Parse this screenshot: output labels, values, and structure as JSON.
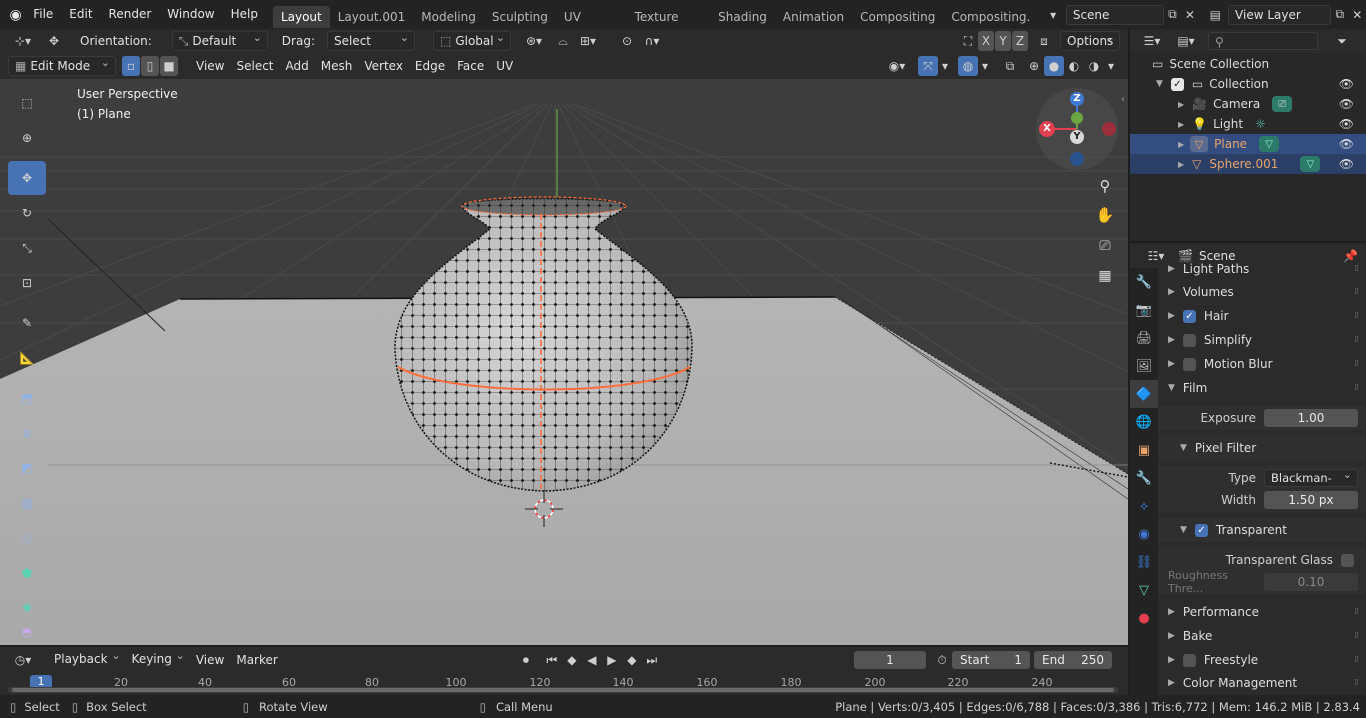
{
  "topbar": {
    "menus": [
      "File",
      "Edit",
      "Render",
      "Window",
      "Help"
    ],
    "workspaces": [
      "Layout",
      "Layout.001",
      "Modeling",
      "Sculpting",
      "UV Editing",
      "Texture Paint",
      "Shading",
      "Animation",
      "Compositing",
      "Compositing."
    ],
    "active_workspace": "Layout",
    "scene": "Scene",
    "view_layer": "View Layer"
  },
  "viewport_header": {
    "orientation_label": "Orientation:",
    "orientation_value": "Default",
    "drag_label": "Drag:",
    "drag_value": "Select Box",
    "transform_orientation": "Global",
    "axes": [
      "X",
      "Y",
      "Z"
    ],
    "options": "Options",
    "mode": "Edit Mode",
    "menus": [
      "View",
      "Select",
      "Add",
      "Mesh",
      "Vertex",
      "Edge",
      "Face",
      "UV"
    ]
  },
  "viewport": {
    "perspective": "User Perspective",
    "object": "(1) Plane",
    "gizmo_axes": {
      "x": "X",
      "y": "Y",
      "z": "Z"
    }
  },
  "outliner": {
    "root": "Scene Collection",
    "collection": "Collection",
    "items": [
      {
        "name": "Camera",
        "color": "#d8d8d8"
      },
      {
        "name": "Light",
        "color": "#d8d8d8"
      },
      {
        "name": "Plane",
        "color": "#e9a36b"
      },
      {
        "name": "Sphere.001",
        "color": "#e9a36b"
      }
    ]
  },
  "properties": {
    "context": "Scene",
    "partial_panel": "Light Paths",
    "panels": [
      {
        "label": "Volumes"
      },
      {
        "label": "Hair",
        "checked": true
      },
      {
        "label": "Simplify",
        "checked": false
      },
      {
        "label": "Motion Blur",
        "checked": false
      }
    ],
    "film": {
      "label": "Film",
      "exposure_label": "Exposure",
      "exposure_value": "1.00",
      "pixel_filter_label": "Pixel Filter",
      "type_label": "Type",
      "type_value": "Blackman-Ha...",
      "width_label": "Width",
      "width_value": "1.50 px",
      "transparent_label": "Transparent",
      "transparent_glass_label": "Transparent Glass",
      "roughness_label": "Roughness Thre...",
      "roughness_value": "0.10"
    },
    "more_panels": [
      {
        "label": "Performance"
      },
      {
        "label": "Bake"
      },
      {
        "label": "Freestyle",
        "checked": false
      },
      {
        "label": "Color Management"
      }
    ]
  },
  "timeline": {
    "menus": [
      "Playback",
      "Keying",
      "View",
      "Marker"
    ],
    "current_frame": "1",
    "start_label": "Start",
    "start_value": "1",
    "end_label": "End",
    "end_value": "250",
    "ruler": [
      "1",
      "20",
      "40",
      "60",
      "80",
      "100",
      "120",
      "140",
      "160",
      "180",
      "200",
      "220",
      "240"
    ]
  },
  "statusbar": {
    "select": "Select",
    "box_select": "Box Select",
    "rotate_view": "Rotate View",
    "call_menu": "Call Menu",
    "stats": "Plane | Verts:0/3,405 | Edges:0/6,788 | Faces:0/3,386 | Tris:6,772 | Mem: 146.2 MiB | 2.83.4"
  },
  "colors": {
    "accent": "#4772b3",
    "selection_orange": "#ff6e3a",
    "x_axis": "#e04050",
    "y_axis": "#6ba644",
    "z_axis": "#3f7ad6"
  }
}
